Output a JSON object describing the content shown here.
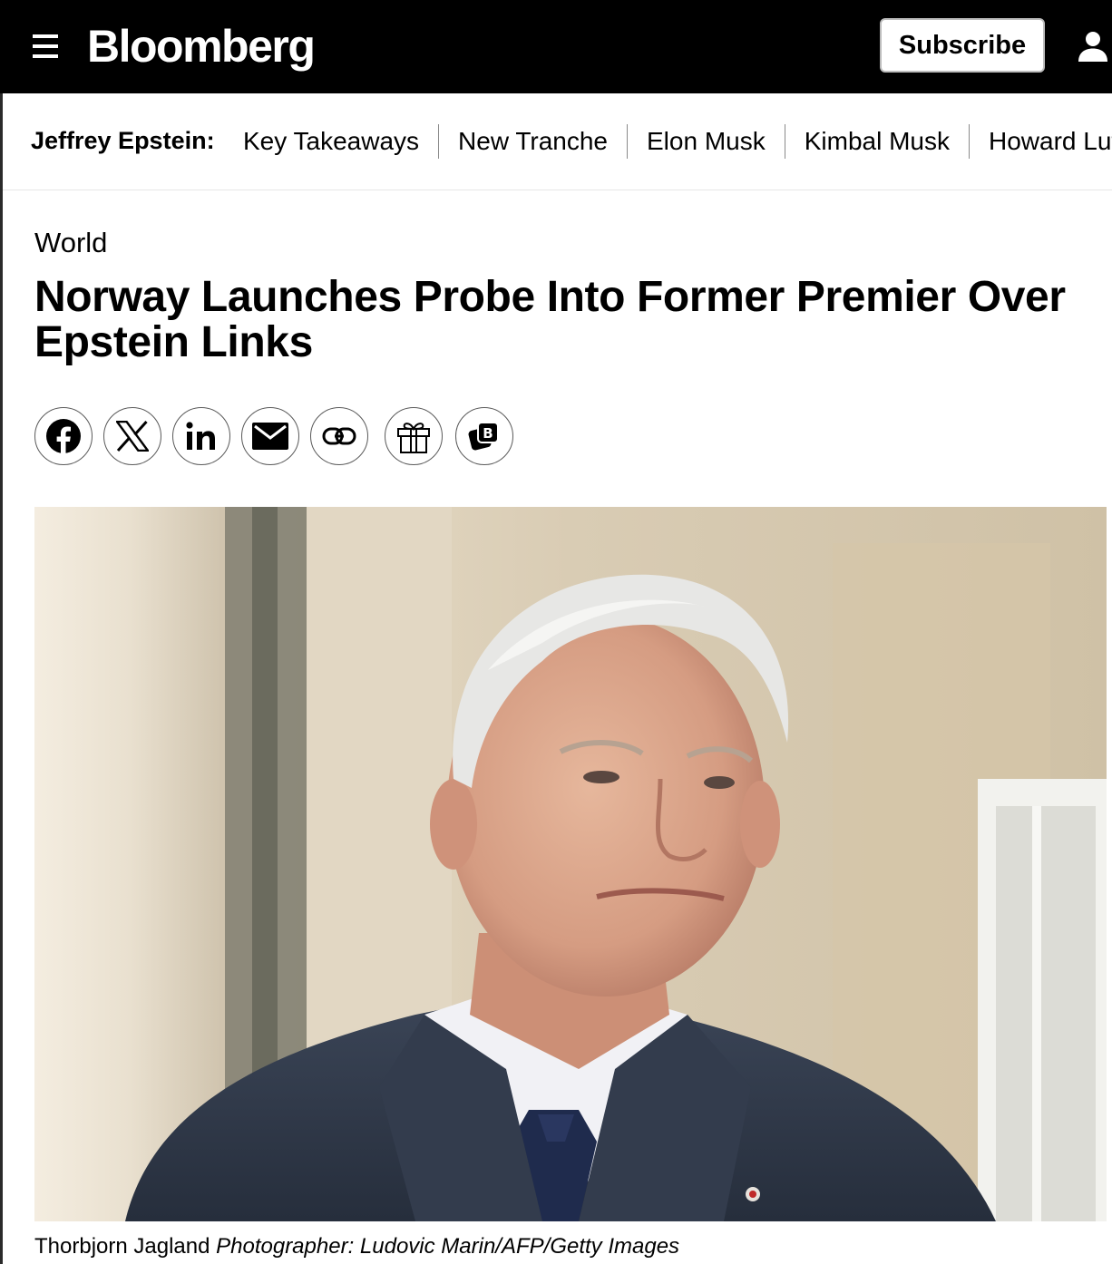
{
  "header": {
    "logo": "Bloomberg",
    "subscribe_label": "Subscribe"
  },
  "topic_nav": {
    "label": "Jeffrey Epstein:",
    "links": [
      "Key Takeaways",
      "New Tranche",
      "Elon Musk",
      "Kimbal Musk",
      "Howard Lutnick"
    ]
  },
  "article": {
    "section": "World",
    "headline": "Norway Launches Probe Into Former Premier Over Epstein Links",
    "share_icons": [
      "facebook-icon",
      "x-icon",
      "linkedin-icon",
      "email-icon",
      "link-icon",
      "gift-icon",
      "bloomberg-app-icon"
    ],
    "image": {
      "caption": "Thorbjorn Jagland",
      "credit": "Photographer: Ludovic Marin/AFP/Getty Images"
    }
  },
  "colors": {
    "header_bg": "#000000",
    "text": "#000000",
    "divider": "#8a8a8a"
  }
}
